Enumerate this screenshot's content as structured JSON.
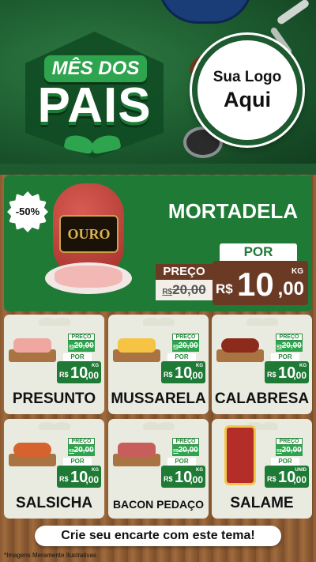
{
  "header": {
    "title_line1": "MÊS DOS",
    "title_line2": "PAIS",
    "logo_line1": "Sua Logo",
    "logo_line2": "Aqui"
  },
  "featured": {
    "name": "MORTADELA",
    "discount": "-50%",
    "brand": "OURO",
    "por_label": "POR",
    "preco_label": "PREÇO",
    "old_prefix": "R$",
    "old_price": "20,00",
    "currency": "R$",
    "price_int": "10",
    "price_dec": ",00",
    "unit": "KG"
  },
  "products": [
    {
      "name": "PRESUNTO",
      "preco_label": "PREÇO",
      "old_prefix": "R$",
      "old_price": "20,00",
      "por_label": "POR",
      "currency": "R$",
      "price_int": "10",
      "price_dec": ",00",
      "unit": "KG"
    },
    {
      "name": "MUSSARELA",
      "preco_label": "PREÇO",
      "old_prefix": "R$",
      "old_price": "20,00",
      "por_label": "POR",
      "currency": "R$",
      "price_int": "10",
      "price_dec": ",00",
      "unit": "KG"
    },
    {
      "name": "CALABRESA",
      "preco_label": "PREÇO",
      "old_prefix": "R$",
      "old_price": "20,00",
      "por_label": "POR",
      "currency": "R$",
      "price_int": "10",
      "price_dec": ",00",
      "unit": "KG"
    },
    {
      "name": "SALSICHA",
      "preco_label": "PREÇO",
      "old_prefix": "R$",
      "old_price": "20,00",
      "por_label": "POR",
      "currency": "R$",
      "price_int": "10",
      "price_dec": ",00",
      "unit": "KG"
    },
    {
      "name": "BACON PEDAÇO",
      "preco_label": "PREÇO",
      "old_prefix": "R$",
      "old_price": "20,00",
      "por_label": "POR",
      "currency": "R$",
      "price_int": "10",
      "price_dec": ",00",
      "unit": "KG"
    },
    {
      "name": "SALAME",
      "preco_label": "PREÇO",
      "old_prefix": "R$",
      "old_price": "20,00",
      "por_label": "POR",
      "currency": "R$",
      "price_int": "10",
      "price_dec": ",00",
      "unit": "UNID"
    }
  ],
  "cta": "Crie seu encarte com este tema!",
  "footnote": "*Imagens Meramente Ilustrativas",
  "colors": {
    "green": "#1f7a36",
    "dark_green": "#1e5a30",
    "brown": "#6b3a25",
    "card": "#e9ebe1"
  }
}
